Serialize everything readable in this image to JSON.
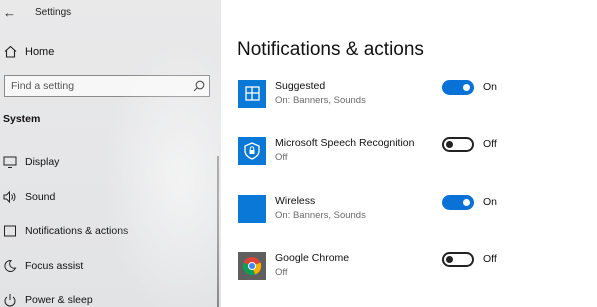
{
  "window": {
    "title": "Settings"
  },
  "sidebar": {
    "home_label": "Home",
    "search": {
      "placeholder": "Find a setting",
      "value": ""
    },
    "section_header": "System",
    "items": [
      {
        "label": "Display",
        "icon": "display-icon"
      },
      {
        "label": "Sound",
        "icon": "speaker-icon"
      },
      {
        "label": "Notifications & actions",
        "icon": "notification-icon"
      },
      {
        "label": "Focus assist",
        "icon": "moon-icon"
      },
      {
        "label": "Power & sleep",
        "icon": "power-icon"
      }
    ]
  },
  "main": {
    "title": "Notifications & actions",
    "apps": [
      {
        "name": "Suggested",
        "status": "On: Banners, Sounds",
        "toggle": "On",
        "enabled": true,
        "icon": "suggested-icon"
      },
      {
        "name": "Microsoft Speech Recognition",
        "status": "Off",
        "toggle": "Off",
        "enabled": false,
        "icon": "speech-recognition-icon"
      },
      {
        "name": "Wireless",
        "status": "On: Banners, Sounds",
        "toggle": "On",
        "enabled": true,
        "icon": "wireless-icon"
      },
      {
        "name": "Google Chrome",
        "status": "Off",
        "toggle": "Off",
        "enabled": false,
        "icon": "chrome-icon"
      }
    ]
  },
  "colors": {
    "accent": "#0a78d7",
    "toggle_on": "#0a72d6",
    "sidebar_bg": "#e6e7e8",
    "status_text": "#6a6a6a"
  }
}
